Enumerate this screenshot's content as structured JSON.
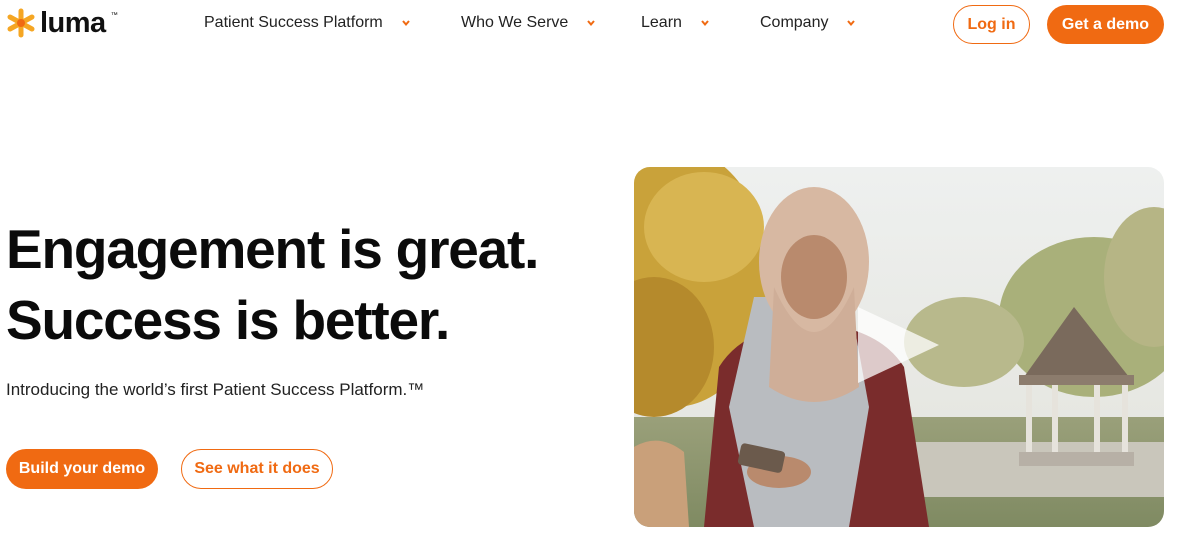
{
  "brand": {
    "name": "luma",
    "tm": "™",
    "accent": "#f06a12"
  },
  "nav": {
    "items": [
      {
        "label": "Patient Success Platform"
      },
      {
        "label": "Who We Serve"
      },
      {
        "label": "Learn"
      },
      {
        "label": "Company"
      }
    ],
    "login_label": "Log in",
    "demo_label": "Get a demo"
  },
  "hero": {
    "title_line1": "Engagement is great.",
    "title_line2": "Success is better.",
    "subtitle": "Introducing the world’s first Patient Success Platform.™",
    "primary_cta": "Build your demo",
    "secondary_cta": "See what it does"
  },
  "video": {
    "icon": "play-icon"
  }
}
